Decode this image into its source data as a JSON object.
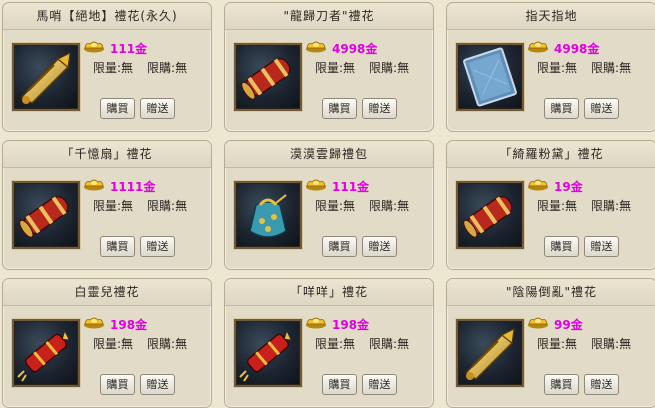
{
  "items": [
    {
      "title": "馬哨【絕地】禮花(永久)",
      "price": "111金",
      "limit_qty": "限量:無",
      "limit_buy": "限購:無",
      "buy": "購買",
      "gift": "贈送",
      "icon": "golden-scroll-icon"
    },
    {
      "title": "\"龍歸刀者\"禮花",
      "price": "4998金",
      "limit_qty": "限量:無",
      "limit_buy": "限購:無",
      "buy": "購買",
      "gift": "贈送",
      "icon": "red-scroll-icon"
    },
    {
      "title": "指天指地",
      "price": "4998金",
      "limit_qty": "限量:無",
      "limit_buy": "限購:無",
      "buy": "購買",
      "gift": "贈送",
      "icon": "blue-card-icon"
    },
    {
      "title": "「千憶扇」禮花",
      "price": "1111金",
      "limit_qty": "限量:無",
      "limit_buy": "限購:無",
      "buy": "購買",
      "gift": "贈送",
      "icon": "red-scroll-icon"
    },
    {
      "title": "漠漠雲歸禮包",
      "price": "111金",
      "limit_qty": "限量:無",
      "limit_buy": "限購:無",
      "buy": "購買",
      "gift": "贈送",
      "icon": "blue-bag-icon"
    },
    {
      "title": "「綺羅粉黛」禮花",
      "price": "19金",
      "limit_qty": "限量:無",
      "limit_buy": "限購:無",
      "buy": "購買",
      "gift": "贈送",
      "icon": "red-scroll-icon"
    },
    {
      "title": "白靈兒禮花",
      "price": "198金",
      "limit_qty": "限量:無",
      "limit_buy": "限購:無",
      "buy": "購買",
      "gift": "贈送",
      "icon": "firecracker-icon"
    },
    {
      "title": "「咩咩」禮花",
      "price": "198金",
      "limit_qty": "限量:無",
      "limit_buy": "限購:無",
      "buy": "購買",
      "gift": "贈送",
      "icon": "firecracker-icon"
    },
    {
      "title": "\"陰陽倒亂\"禮花",
      "price": "99金",
      "limit_qty": "限量:無",
      "limit_buy": "限購:無",
      "buy": "購買",
      "gift": "贈送",
      "icon": "golden-scroll-icon"
    }
  ],
  "colors": {
    "price": "#e000e0",
    "card": "#e1dbc8",
    "background": "#ede6d1"
  }
}
